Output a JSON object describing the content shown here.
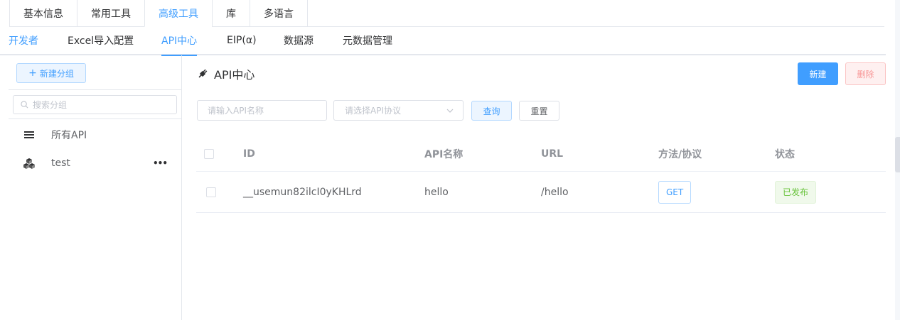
{
  "top_tabs": [
    {
      "label": "基本信息",
      "active": false
    },
    {
      "label": "常用工具",
      "active": false
    },
    {
      "label": "高级工具",
      "active": true
    },
    {
      "label": "库",
      "active": false
    },
    {
      "label": "多语言",
      "active": false
    }
  ],
  "sub_tabs": [
    {
      "label": "开发者"
    },
    {
      "label": "Excel导入配置"
    },
    {
      "label": "API中心"
    },
    {
      "label": "EIP(α)"
    },
    {
      "label": "数据源"
    },
    {
      "label": "元数据管理"
    }
  ],
  "sidebar": {
    "new_group_label": "新建分组",
    "search_placeholder": "搜索分组",
    "groups": [
      {
        "label": "所有API",
        "icon": "list-icon"
      },
      {
        "label": "test",
        "icon": "cubes-icon",
        "more": "•••"
      }
    ]
  },
  "main": {
    "title": "API中心",
    "title_icon": "plug-icon",
    "new_label": "新建",
    "delete_label": "删除",
    "filter": {
      "name_placeholder": "请输入API名称",
      "protocol_placeholder": "请选择API协议",
      "query_label": "查询",
      "reset_label": "重置"
    },
    "table": {
      "headers": {
        "id": "ID",
        "name": "API名称",
        "url": "URL",
        "method": "方法/协议",
        "status": "状态"
      },
      "rows": [
        {
          "id": "__usemun82ilcI0yKHLrd",
          "name": "hello",
          "url": "/hello",
          "method": "GET",
          "status": "已发布"
        }
      ]
    }
  },
  "colors": {
    "accent": "#409eff",
    "danger": "#f56c6c",
    "success": "#67c23a"
  }
}
